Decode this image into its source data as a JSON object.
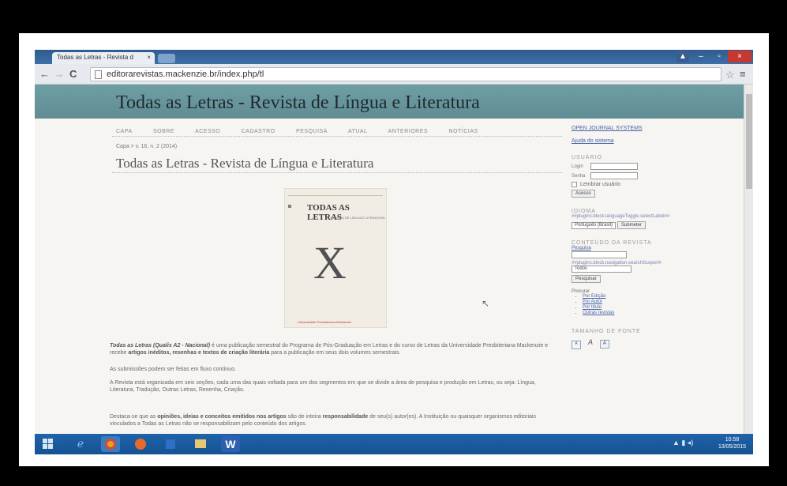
{
  "browser": {
    "tab_title": "Todas as Letras - Revista d",
    "tab_close": "×",
    "url": "editorarevistas.mackenzie.br/index.php/tl",
    "back": "←",
    "forward": "→",
    "reload": "C",
    "star": "☆",
    "menu": "≡",
    "win_user": "▲",
    "win_min": "–",
    "win_max": "▫",
    "win_close": "×"
  },
  "site": {
    "journal_title": "Todas as Letras - Revista de Língua e Literatura",
    "nav": [
      "CAPA",
      "SOBRE",
      "ACESSO",
      "CADASTRO",
      "PESQUISA",
      "ATUAL",
      "ANTERIORES",
      "NOTÍCIAS"
    ],
    "breadcrumb": "Capa > v. 16, n. 2 (2014)",
    "page_title": "Todas as Letras - Revista de Língua e Literatura"
  },
  "cover": {
    "title": "TODAS AS LETRAS",
    "subtitle": "REVISTA DE LÍNGUA E LITERATURA",
    "big_letter": "X",
    "footer": "Universidade Presbiteriana Mackenzie"
  },
  "content": {
    "p1_title": "Todas as Letras (Qualis A2 - Nacional)",
    "p1_a": " é uma publicação semestral do Programa de Pós-Graduação em Letras e do curso de Letras da Universidade Presbiteriana Mackenzie e recebe ",
    "p1_bold": "artigos inéditos, resenhas e textos de criação literária",
    "p1_b": " para a publicação em seus dois volumes semestrais.",
    "p2": "As submissões podem ser feitas em fluxo contínuo.",
    "p3": "A Revista está organizada em seis seções, cada uma das quais voltada para um dos segmentos em que se divide a área de pesquisa e produção em Letras, ou seja: Língua, Literatura, Tradução, Outras Letras, Resenha, Criação.",
    "p4_a": "Destaca-se que as ",
    "p4_bold": "opiniões, ideias e conceitos emitidos nos artigos",
    "p4_b": " são de inteira ",
    "p4_bold2": "responsabilidade",
    "p4_c": " de seu(s) autor(es). A Instituição ou quaisquer organismos editoriais vinculados a Todas as Letras não se responsabilizam pelo conteúdo dos artigos."
  },
  "sidebar": {
    "ojs_link": "OPEN JOURNAL SYSTEMS",
    "help_link": "Ajuda do sistema",
    "user_heading": "USUÁRIO",
    "login_label": "Login",
    "password_label": "Senha",
    "remember_label": "Lembrar usuário",
    "access_button": "Acesso",
    "language_heading": "IDIOMA",
    "language_key": "##plugins.block.languageToggle.selectLabel##",
    "language_value": "Português (Brasil)",
    "submit_button": "Submeter",
    "content_heading": "CONTEÚDO DA REVISTA",
    "search_label": "Pesquisa",
    "scope_key": "##plugins.block.navigation.searchScope##",
    "scope_value": "Todos",
    "search_button": "Pesquisar",
    "browse_label": "Procurar",
    "browse_items": [
      "Por Edição",
      "Por Autor",
      "Por título",
      "Outras revistas"
    ],
    "font_heading": "TAMANHO DE FONTE",
    "font_small": "A",
    "font_medium": "A",
    "font_large": "A"
  },
  "taskbar": {
    "ie": "e",
    "word": "W",
    "clock_time": "10:58",
    "clock_date": "13/05/2015",
    "tray": "▲  ▮  ◂)"
  }
}
